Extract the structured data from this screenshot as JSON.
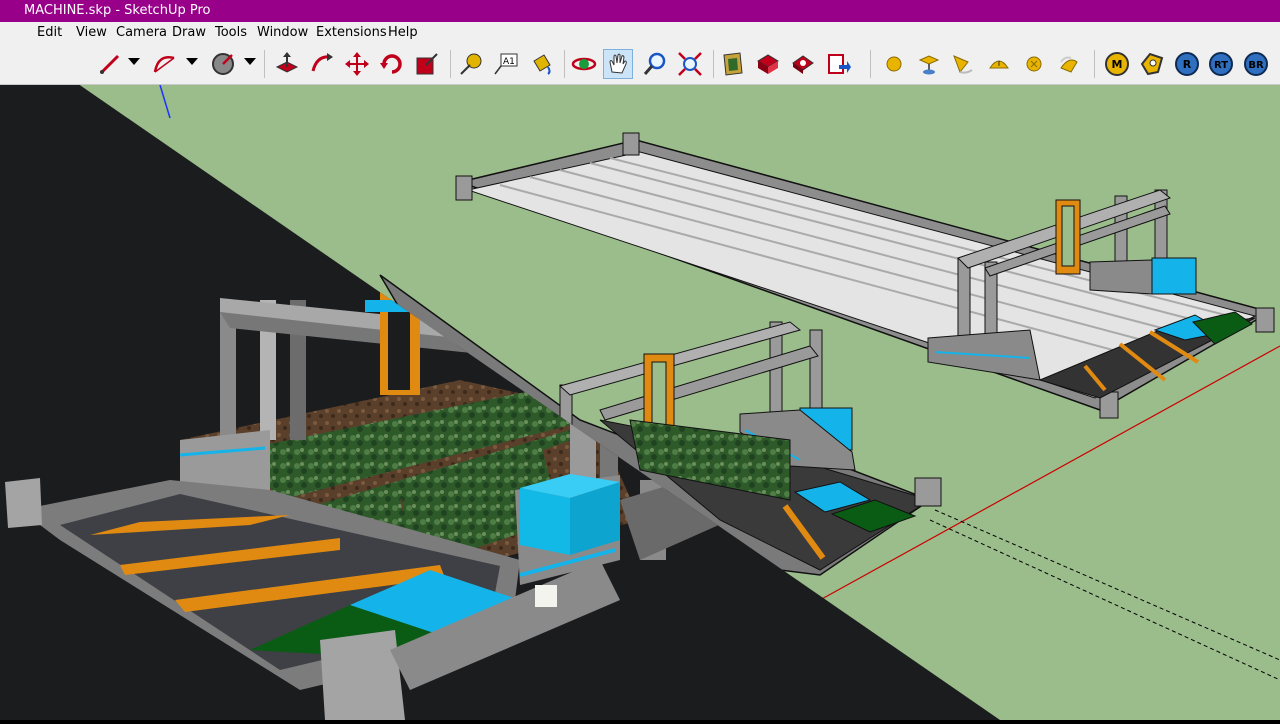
{
  "window": {
    "title": "MACHINE.skp - SketchUp Pro",
    "titlebar_color": "#98008a"
  },
  "menu": [
    "Edit",
    "View",
    "Camera",
    "Draw",
    "Tools",
    "Window",
    "Extensions",
    "Help"
  ],
  "toolbar": {
    "tools": [
      "line-icon",
      "arc-icon",
      "protractor-icon",
      "push-pull-icon",
      "follow-me-icon",
      "move-icon",
      "rotate-icon",
      "scale-icon",
      "tape-measure-icon",
      "text-icon",
      "paint-bucket-icon",
      "orbit-icon",
      "pan-icon",
      "zoom-icon",
      "zoom-extents-icon",
      "3d-warehouse-icon",
      "extension-warehouse-icon",
      "layout-icon",
      "send-to-layout-icon",
      "sandbox-icon",
      "sandbox-stamp-icon",
      "sandbox-drape-icon",
      "sandbox-smoove-icon",
      "sandbox-add-detail-icon",
      "sandbox-flip-icon",
      "m-icon",
      "tag-icon",
      "r-icon",
      "rt-icon",
      "br-icon"
    ],
    "round_labels": {
      "m": "M",
      "r": "R",
      "rt": "RT",
      "br": "BR"
    }
  },
  "colors": {
    "sky_green": "#9bbd8b",
    "accent_cyan": "#12b8e6",
    "stripe_orange": "#e08a12",
    "grass": "#0a5b14",
    "render_dark": "#1b1c1e"
  }
}
